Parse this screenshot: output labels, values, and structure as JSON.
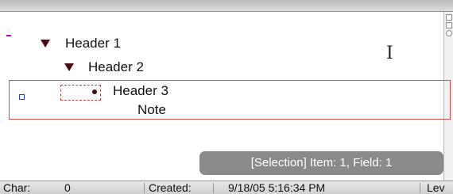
{
  "outline": {
    "rows": [
      {
        "label": "Header 1"
      },
      {
        "label": "Header 2"
      },
      {
        "label": "Header 3",
        "note": "Note"
      }
    ]
  },
  "tooltip": {
    "text": "[Selection]  Item: 1,  Field: 1"
  },
  "statusbar": {
    "char_label": "Char:",
    "char_value": "0",
    "created_label": "Created:",
    "created_value": "9/18/05 5:16:34 PM",
    "level_label": "Lev"
  },
  "colors": {
    "triangle": "#4a0d0d",
    "selection_border": "#d34b4b",
    "margin_dash": "#c000c0",
    "margin_box": "#1a3fff",
    "tooltip_bg": "#8a8a8a"
  },
  "icons": [
    "disclosure-triangle-icon",
    "bullet-icon",
    "ibeam-cursor-icon"
  ]
}
